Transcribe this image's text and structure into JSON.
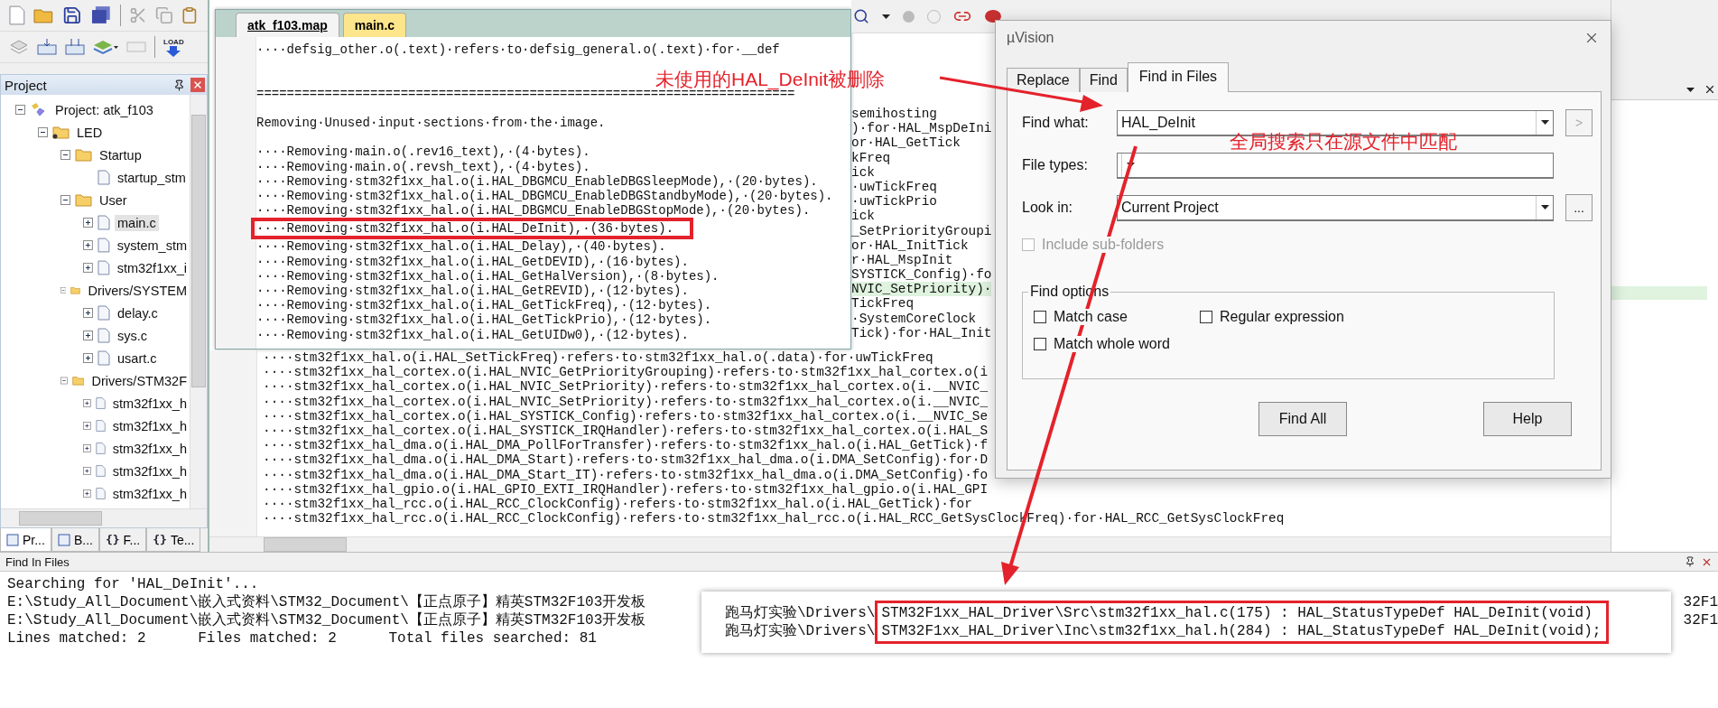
{
  "toolbar": {
    "load_label": "LOAD"
  },
  "project_panel": {
    "title": "Project",
    "tree": [
      {
        "kind": "project",
        "label": "Project: atk_f103",
        "expanded": true,
        "selected": false,
        "children": [
          {
            "kind": "target",
            "label": "LED",
            "expanded": true,
            "selected": false,
            "children": [
              {
                "kind": "folder",
                "label": "Startup",
                "expanded": true,
                "selected": false,
                "children": [
                  {
                    "kind": "file",
                    "label": "startup_stm",
                    "selected": false
                  }
                ]
              },
              {
                "kind": "folder",
                "label": "User",
                "expanded": true,
                "selected": false,
                "children": [
                  {
                    "kind": "file",
                    "label": "main.c",
                    "expanded": false,
                    "selected": true
                  },
                  {
                    "kind": "file",
                    "label": "system_stm",
                    "expanded": false,
                    "selected": false
                  },
                  {
                    "kind": "file",
                    "label": "stm32f1xx_i",
                    "expanded": false,
                    "selected": false
                  }
                ]
              },
              {
                "kind": "folder",
                "label": "Drivers/SYSTEM",
                "expanded": true,
                "selected": false,
                "children": [
                  {
                    "kind": "file",
                    "label": "delay.c",
                    "expanded": false,
                    "selected": false
                  },
                  {
                    "kind": "file",
                    "label": "sys.c",
                    "expanded": false,
                    "selected": false
                  },
                  {
                    "kind": "file",
                    "label": "usart.c",
                    "expanded": false,
                    "selected": false
                  }
                ]
              },
              {
                "kind": "folder",
                "label": "Drivers/STM32F",
                "expanded": true,
                "selected": false,
                "children": [
                  {
                    "kind": "file",
                    "label": "stm32f1xx_h",
                    "expanded": false,
                    "selected": false
                  },
                  {
                    "kind": "file",
                    "label": "stm32f1xx_h",
                    "expanded": false,
                    "selected": false
                  },
                  {
                    "kind": "file",
                    "label": "stm32f1xx_h",
                    "expanded": false,
                    "selected": false
                  },
                  {
                    "kind": "file",
                    "label": "stm32f1xx_h",
                    "expanded": false,
                    "selected": false
                  },
                  {
                    "kind": "file",
                    "label": "stm32f1xx_h",
                    "expanded": false,
                    "selected": false
                  }
                ]
              }
            ]
          }
        ]
      }
    ],
    "tabs": [
      {
        "label": "Pr...",
        "selected": true
      },
      {
        "label": "B...",
        "selected": false
      },
      {
        "glyph": "{}",
        "label": "F...",
        "selected": false
      },
      {
        "glyph": "{}",
        "label": "Te...",
        "selected": false
      }
    ]
  },
  "editor": {
    "tabs": [
      {
        "label": "atk_f103.map",
        "selected": true
      },
      {
        "label": "main.c",
        "selected": false
      }
    ],
    "map_lines": [
      {
        "text": "····defsig_other.o(.text)·refers·to·defsig_general.o(.text)·for·__def",
        "annotated": false
      },
      {
        "kind": "rule",
        "text": "=======================================================================",
        "gap_before": true,
        "annotated": false
      },
      {
        "text": "Removing·Unused·input·sections·from·the·image.",
        "gap_before": true,
        "annotated": false
      },
      {
        "text": "····Removing·main.o(.rev16_text),·(4·bytes).",
        "gap_before": true,
        "annotated": false
      },
      {
        "text": "····Removing·main.o(.revsh_text),·(4·bytes).",
        "annotated": false
      },
      {
        "text": "····Removing·stm32f1xx_hal.o(i.HAL_DBGMCU_EnableDBGSleepMode),·(20·bytes).",
        "annotated": false
      },
      {
        "text": "····Removing·stm32f1xx_hal.o(i.HAL_DBGMCU_EnableDBGStandbyMode),·(20·bytes).",
        "annotated": false
      },
      {
        "text": "····Removing·stm32f1xx_hal.o(i.HAL_DBGMCU_EnableDBGStopMode),·(20·bytes).",
        "annotated": false
      },
      {
        "text": "····Removing·stm32f1xx_hal.o(i.HAL_DeInit),·(36·bytes).",
        "annotated": true
      },
      {
        "text": "····Removing·stm32f1xx_hal.o(i.HAL_Delay),·(40·bytes).",
        "annotated": false
      },
      {
        "text": "····Removing·stm32f1xx_hal.o(i.HAL_GetDEVID),·(16·bytes).",
        "annotated": false
      },
      {
        "text": "····Removing·stm32f1xx_hal.o(i.HAL_GetHalVersion),·(8·bytes).",
        "annotated": false
      },
      {
        "text": "····Removing·stm32f1xx_hal.o(i.HAL_GetREVID),·(12·bytes).",
        "annotated": false
      },
      {
        "text": "····Removing·stm32f1xx_hal.o(i.HAL_GetTickFreq),·(12·bytes).",
        "annotated": false
      },
      {
        "text": "····Removing·stm32f1xx_hal.o(i.HAL_GetTickPrio),·(12·bytes).",
        "annotated": false
      },
      {
        "text": "····Removing·stm32f1xx_hal.o(i.HAL_GetUIDw0),·(12·bytes).",
        "annotated": false
      }
    ],
    "fragments": [
      {
        "text": "semihosting",
        "highlighted": false
      },
      {
        "text": ")·for·HAL_MspDeIni",
        "highlighted": false
      },
      {
        "text": "or·HAL_GetTick",
        "highlighted": false
      },
      {
        "text": "kFreq",
        "highlighted": false
      },
      {
        "text": "ick",
        "highlighted": false
      },
      {
        "text": "·uwTickFreq",
        "highlighted": false
      },
      {
        "text": "·uwTickPrio",
        "highlighted": false
      },
      {
        "text": "ick",
        "highlighted": false
      },
      {
        "text": "_SetPriorityGroupi",
        "highlighted": false
      },
      {
        "text": "or·HAL_InitTick",
        "highlighted": false
      },
      {
        "text": "r·HAL_MspInit",
        "highlighted": false
      },
      {
        "text": "SYSTICK_Config)·fo",
        "highlighted": false
      },
      {
        "text": "NVIC_SetPriority)·",
        "highlighted": true
      },
      {
        "text": "TickFreq",
        "highlighted": false
      },
      {
        "text": "·SystemCoreClock",
        "highlighted": false
      },
      {
        "text": "Tick)·for·HAL_Init",
        "highlighted": false
      }
    ],
    "lines": [
      "····stm32f1xx_hal.o(i.HAL_SetTickFreq)·refers·to·stm32f1xx_hal.o(.data)·for·uwTickFreq",
      "····stm32f1xx_hal_cortex.o(i.HAL_NVIC_GetPriorityGrouping)·refers·to·stm32f1xx_hal_cortex.o(i",
      "····stm32f1xx_hal_cortex.o(i.HAL_NVIC_SetPriority)·refers·to·stm32f1xx_hal_cortex.o(i.__NVIC_",
      "····stm32f1xx_hal_cortex.o(i.HAL_NVIC_SetPriority)·refers·to·stm32f1xx_hal_cortex.o(i.__NVIC_",
      "····stm32f1xx_hal_cortex.o(i.HAL_SYSTICK_Config)·refers·to·stm32f1xx_hal_cortex.o(i.__NVIC_Se",
      "····stm32f1xx_hal_cortex.o(i.HAL_SYSTICK_IRQHandler)·refers·to·stm32f1xx_hal_cortex.o(i.HAL_S",
      "····stm32f1xx_hal_dma.o(i.HAL_DMA_PollForTransfer)·refers·to·stm32f1xx_hal.o(i.HAL_GetTick)·f",
      "····stm32f1xx_hal_dma.o(i.HAL_DMA_Start)·refers·to·stm32f1xx_hal_dma.o(i.DMA_SetConfig)·for·D",
      "····stm32f1xx_hal_dma.o(i.HAL_DMA_Start_IT)·refers·to·stm32f1xx_hal_dma.o(i.DMA_SetConfig)·fo",
      "····stm32f1xx_hal_gpio.o(i.HAL_GPIO_EXTI_IRQHandler)·refers·to·stm32f1xx_hal_gpio.o(i.HAL_GPI",
      "····stm32f1xx_hal_rcc.o(i.HAL_RCC_ClockConfig)·refers·to·stm32f1xx_hal.o(i.HAL_GetTick)·for",
      "····stm32f1xx_hal_rcc.o(i.HAL_RCC_ClockConfig)·refers·to·stm32f1xx_hal_rcc.o(i.HAL_RCC_GetSysClockFreq)·for·HAL_RCC_GetSysClockFreq"
    ]
  },
  "dialog": {
    "title": "µVision",
    "tabs": [
      {
        "label": "Replace",
        "selected": false
      },
      {
        "label": "Find",
        "selected": false
      },
      {
        "label": "Find in Files",
        "selected": true
      }
    ],
    "fields": [
      {
        "label": "Find what:",
        "value": "HAL_DeInit",
        "button": ">",
        "button_disabled": true
      },
      {
        "label": "File types:"
      },
      {
        "label": "Look in:",
        "value": "Current Project",
        "button": "...",
        "button_disabled": false
      }
    ],
    "include_subfolders": {
      "label": "Include sub-folders",
      "checked": false,
      "disabled": true
    },
    "options": {
      "title": "Find options",
      "items": [
        {
          "label": "Match case",
          "checked": false
        },
        {
          "label": "Regular expression",
          "checked": false
        },
        {
          "label": "Match whole word",
          "checked": false
        }
      ]
    },
    "buttons": [
      "Find All",
      "Help"
    ]
  },
  "annotations": [
    "未使用的HAL_DeInit被删除",
    "全局搜索只在源文件中匹配"
  ],
  "find_in_files": {
    "title": "Find In Files",
    "lines": [
      {
        "text": "Searching for 'HAL_DeInit'..."
      },
      {
        "text": "E:\\Study_All_Document\\嵌入式资料\\STM32_Document\\【正点原子】精英STM32F103开发板",
        "tail": "32F1"
      },
      {
        "text": "E:\\Study_All_Document\\嵌入式资料\\STM32_Document\\【正点原子】精英STM32F103开发板",
        "tail": "32F1"
      },
      {
        "text": "Lines matched: 2      Files matched: 2      Total files searched: 81"
      }
    ],
    "callout": {
      "rows": [
        {
          "prefix": "跑马灯实验\\Drivers\\",
          "match": "STM32F1xx_HAL_Driver\\Src\\stm32f1xx_hal.c(175) : HAL_StatusTypeDef HAL_DeInit(void)"
        },
        {
          "prefix": "跑马灯实验\\Drivers\\",
          "match": "STM32F1xx_HAL_Driver\\Inc\\stm32f1xx_hal.h(284) : HAL_StatusTypeDef HAL_DeInit(void);"
        }
      ]
    }
  }
}
